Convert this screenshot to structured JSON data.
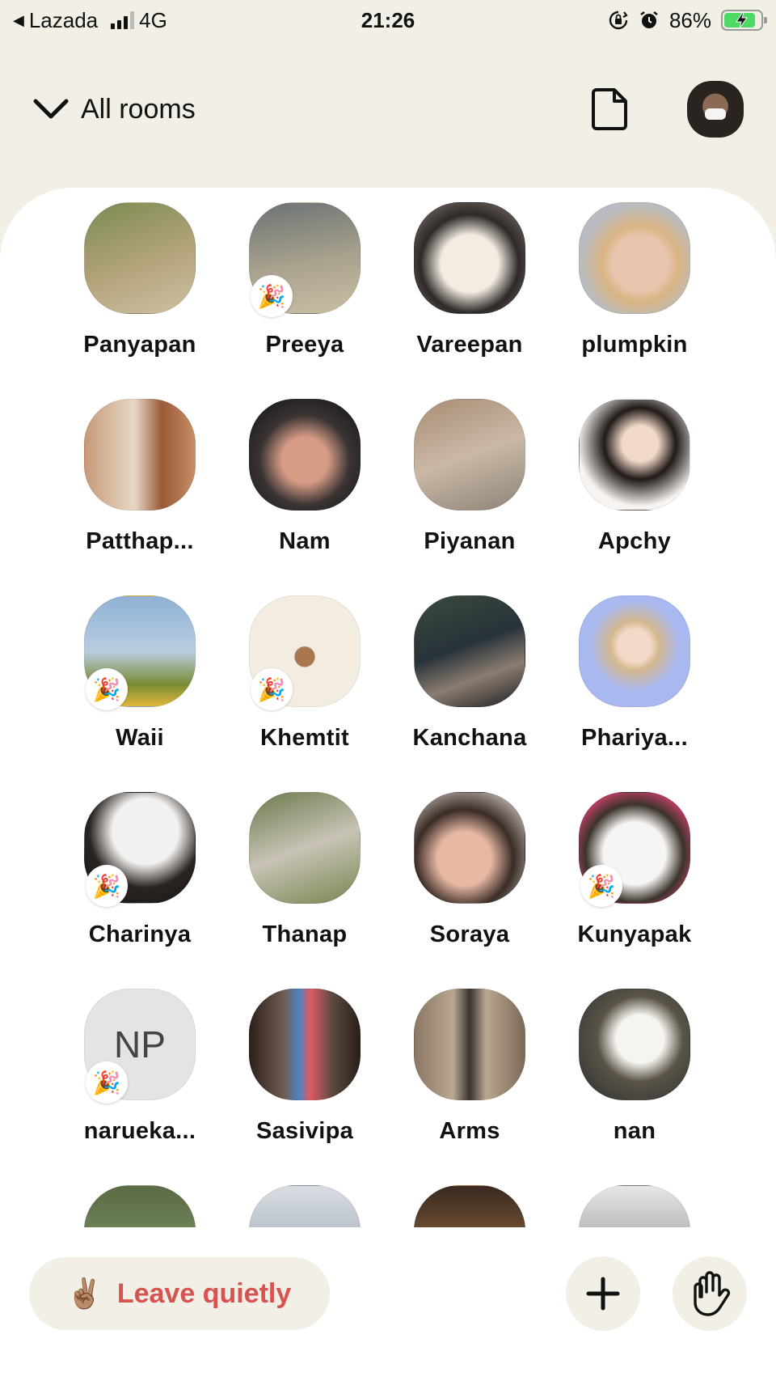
{
  "status_bar": {
    "back_app": "Lazada",
    "network": "4G",
    "time": "21:26",
    "battery": "86%",
    "battery_level": 0.86
  },
  "header": {
    "title": "All rooms",
    "icons": [
      "chevron-down-icon",
      "document-icon",
      "profile-avatar"
    ]
  },
  "people": [
    {
      "name": "Panyapan",
      "badge": false,
      "bg": "linear-gradient(160deg,#7c8a52,#b3a47c 55%,#cfc0a3)"
    },
    {
      "name": "Preeya",
      "badge": true,
      "bg": "linear-gradient(170deg,#6c7374,#a9a28e 55%,#c9bfa4)"
    },
    {
      "name": "Vareepan",
      "badge": false,
      "bg": "radial-gradient(circle at 50% 55%,#f3ece3 0 35%,#2e2a28 60%,#8b7f77 100%)"
    },
    {
      "name": "plumpkin",
      "badge": false,
      "bg": "radial-gradient(circle at 55% 55%,#e9c4ae 0 32%,#d9b483 45%,#b8bcc2 70%)"
    },
    {
      "name": "Patthap...",
      "badge": false,
      "bg": "linear-gradient(90deg,#c79a7a,#e7d7c6 45%,#9a5a36 70%,#c58e66)"
    },
    {
      "name": "Nam",
      "badge": false,
      "bg": "radial-gradient(circle at 50% 55%,#d79c86 0 28%,#3a3433 55%,#111 100%)"
    },
    {
      "name": "Piyanan",
      "badge": false,
      "bg": "linear-gradient(160deg,#a98d74,#cab8a6 50%,#8d8478)"
    },
    {
      "name": "Apchy",
      "badge": false,
      "bg": "radial-gradient(circle at 55% 40%,#f2d8c9 0 20%,#201a18 40%,#f7f3f1 70%)"
    },
    {
      "name": "Waii",
      "badge": true,
      "bg": "linear-gradient(180deg,#8fb1d4,#b9cde0 50%,#7a8c36 80%,#e0b63a)"
    },
    {
      "name": "Khemtit",
      "badge": true,
      "bg": "radial-gradient(circle at 50% 55%,#a8774f 0 12%,#f3ece0 13%)"
    },
    {
      "name": "Kanchana",
      "badge": false,
      "bg": "linear-gradient(160deg,#3c4a3c,#28323a 45%,#8b7d70 70%,#1e1e22)"
    },
    {
      "name": "Phariya...",
      "badge": false,
      "bg": "radial-gradient(circle at 50% 45%,#f3d9c8 0 20%,#d4b88e 30%,#a9b8ef 55%)"
    },
    {
      "name": "Charinya",
      "badge": true,
      "bg": "radial-gradient(circle at 55% 35%,#f3f1ef 0 35%,#2b2522 60%,#131110)"
    },
    {
      "name": "Thanap",
      "badge": false,
      "bg": "linear-gradient(160deg,#6c7a4e,#c8c3b5 50%,#7a8652)"
    },
    {
      "name": "Soraya",
      "badge": false,
      "bg": "radial-gradient(circle at 45% 60%,#e7b8a4 0 30%,#3a2c26 55%,#d2cbc3 90%)"
    },
    {
      "name": "Kunyapak",
      "badge": true,
      "bg": "radial-gradient(circle at 50% 55%,#f7f5f3 0 38%,#3b332c 60%,#c24067 80%)"
    },
    {
      "name": "narueka...",
      "badge": true,
      "initials": "NP",
      "bg": "#e4e4e6"
    },
    {
      "name": "Sasivipa",
      "badge": false,
      "bg": "linear-gradient(90deg,#2d211c,#6e5a4e 30%,#4f84c2 45%,#e05a62 55%,#5c4a40 75%,#2a1f1a)"
    },
    {
      "name": "Arms",
      "badge": false,
      "bg": "linear-gradient(90deg,#8b7764,#b9a791 35%,#3a3430 50%,#b9a791 65%,#7c6a58)"
    },
    {
      "name": "nan",
      "badge": false,
      "bg": "radial-gradient(circle at 55% 45%,#f6f4f0 0 28%,#5a5448 50%,#2c2d30)"
    },
    {
      "name": "",
      "badge": false,
      "bg": "linear-gradient(180deg,#5b6b45,#8aa070)"
    },
    {
      "name": "",
      "badge": false,
      "bg": "linear-gradient(180deg,#d9dde2,#8b98a8)"
    },
    {
      "name": "",
      "badge": false,
      "bg": "linear-gradient(180deg,#3a2a20,#b07a4a)"
    },
    {
      "name": "",
      "badge": false,
      "bg": "linear-gradient(180deg,#e8e6e4,#7c7c7c)"
    }
  ],
  "footer": {
    "leave_emoji": "✌🏽",
    "leave_label": "Leave quietly",
    "leave_color": "#d7534f",
    "add_icon": "plus-icon",
    "hand_icon": "raise-hand-icon"
  },
  "colors": {
    "background": "#f1efe6",
    "panel": "#ffffff",
    "accent": "#d7534f"
  }
}
